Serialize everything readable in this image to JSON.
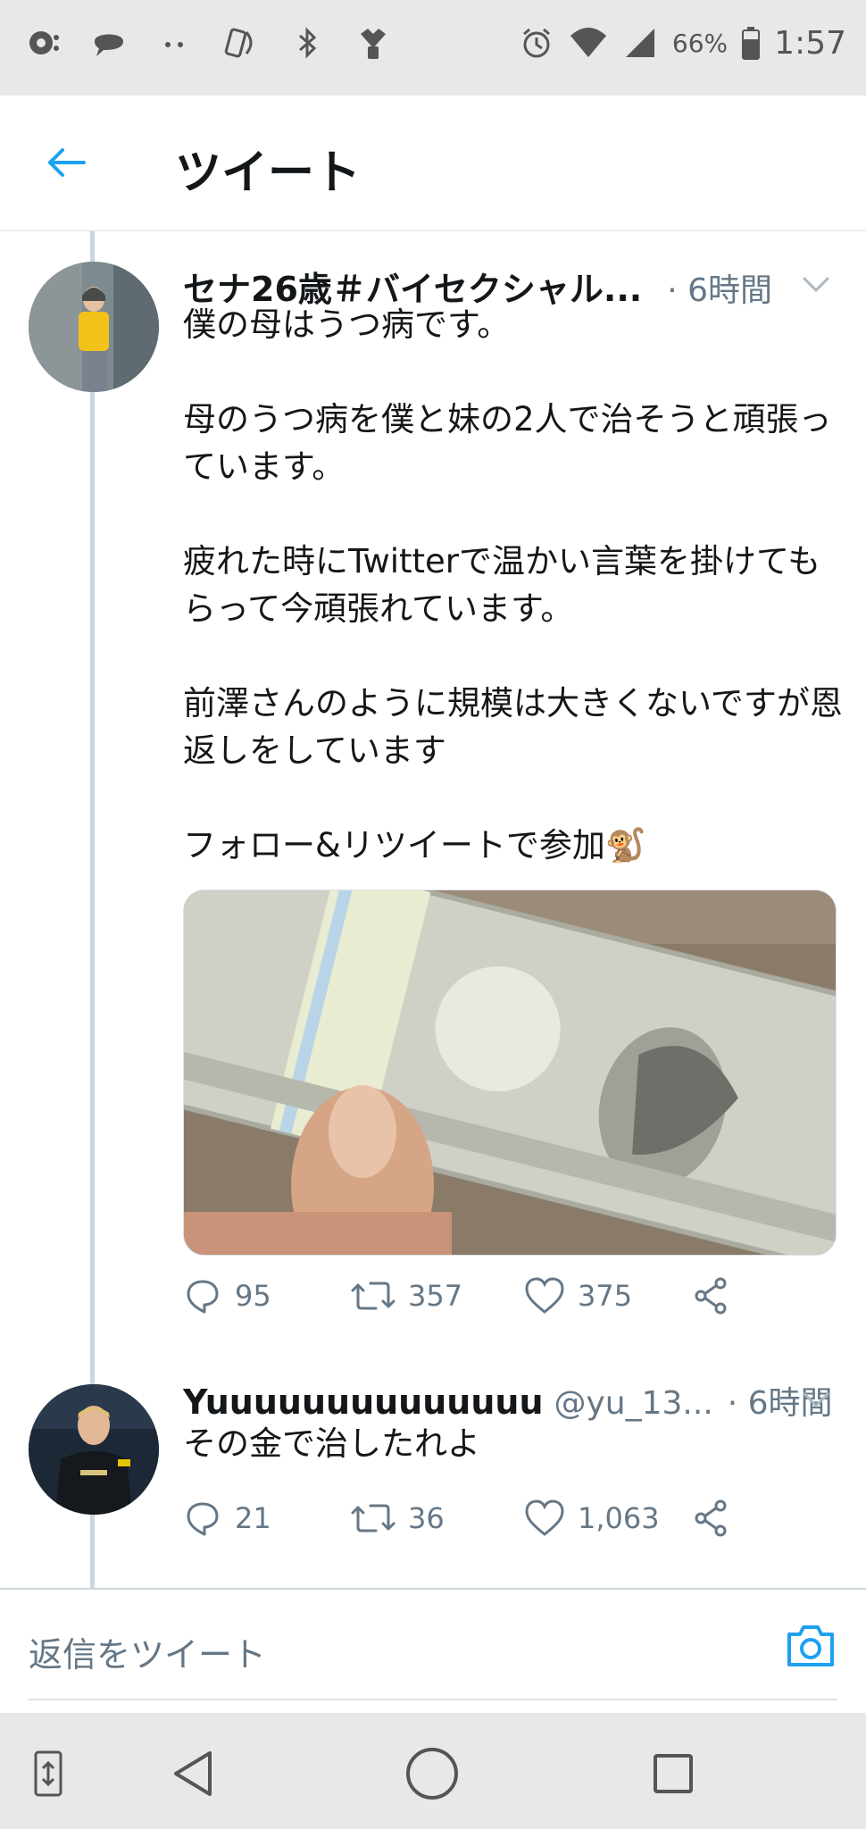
{
  "status_bar": {
    "battery": "66%",
    "time": "1:57"
  },
  "header": {
    "title": "ツイート",
    "back_icon": "arrow-left-icon"
  },
  "tweets": [
    {
      "display_name": "セナ26歳＃バイセクシャル...",
      "username": "",
      "time": "· 6時間",
      "body": "僕の母はうつ病です。\n\n母のうつ病を僕と妹の2人で治そうと頑張っています。\n\n疲れた時にTwitterで温かい言葉を掛けてもらって今頑張れています。\n\n前澤さんのように規模は大きくないですが恩返しをしています\n\nフォロー&リツイートで参加🐒",
      "replies": "95",
      "retweets": "357",
      "likes": "375",
      "has_media": true
    },
    {
      "display_name": "Yuuuuuuuuuuuuuu",
      "username": "@yu_13...",
      "time": "· 6時間",
      "body": "その金で治したれよ",
      "replies": "21",
      "retweets": "36",
      "likes": "1,063",
      "has_media": false
    }
  ],
  "reply_bar": {
    "placeholder": "返信をツイート"
  },
  "colors": {
    "accent": "#1da1f2",
    "text": "#14171a",
    "secondary": "#657786",
    "divider": "#ccd6dd"
  }
}
